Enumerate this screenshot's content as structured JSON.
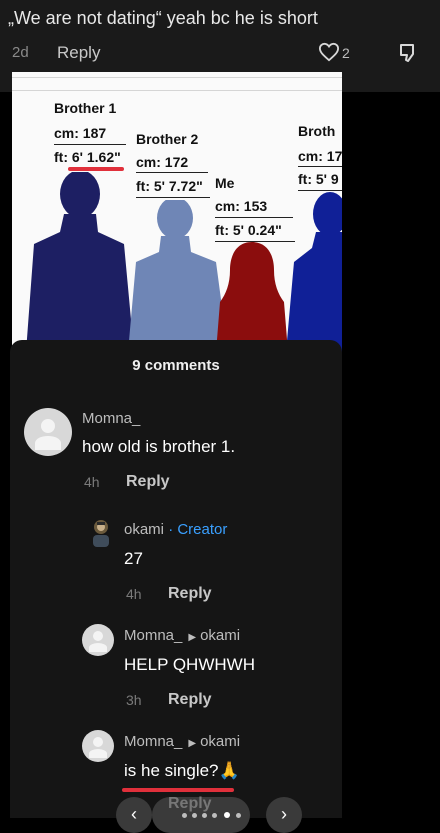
{
  "top_comment": {
    "text": "„We are not dating“ yeah bc he is short",
    "time": "2d",
    "reply_label": "Reply",
    "likes": "2"
  },
  "comparison": {
    "brother1": {
      "name": "Brother 1",
      "cm": "cm: 187",
      "ft": "ft: 6' 1.62\""
    },
    "brother2": {
      "name": "Brother 2",
      "cm": "cm: 172",
      "ft": "ft: 5' 7.72\""
    },
    "me": {
      "name": "Me",
      "cm": "cm: 153",
      "ft": "ft: 5' 0.24\""
    },
    "brother3": {
      "name": "Broth",
      "cm": "cm: 17",
      "ft": "ft: 5' 9"
    },
    "colors": {
      "brother1": "#1d1f63",
      "brother2": "#6f86b6",
      "me": "#8b0d0d",
      "brother3": "#102097"
    }
  },
  "panel": {
    "count_label": "9 comments",
    "comments": [
      {
        "user": "Momna_",
        "text": "how old is brother 1.",
        "time": "4h",
        "reply": "Reply"
      },
      {
        "user": "okami",
        "creator": "· Creator",
        "text": "27",
        "time": "4h",
        "reply": "Reply"
      },
      {
        "user": "Momna_",
        "to": "okami",
        "text": "HELP QHWHWH",
        "time": "3h",
        "reply": "Reply"
      },
      {
        "user": "Momna_",
        "to": "okami",
        "text": "is he single?🙏",
        "time": "3h",
        "reply": "Reply"
      }
    ],
    "nav": {
      "prev": "‹",
      "next": "›"
    }
  },
  "icons": [
    "heart-icon",
    "dislike-icon",
    "avatar-icon",
    "chevron-left-icon",
    "chevron-right-icon",
    "folded-hands-emoji"
  ],
  "accent": "#3aa0ff",
  "highlight": "#e0303b"
}
